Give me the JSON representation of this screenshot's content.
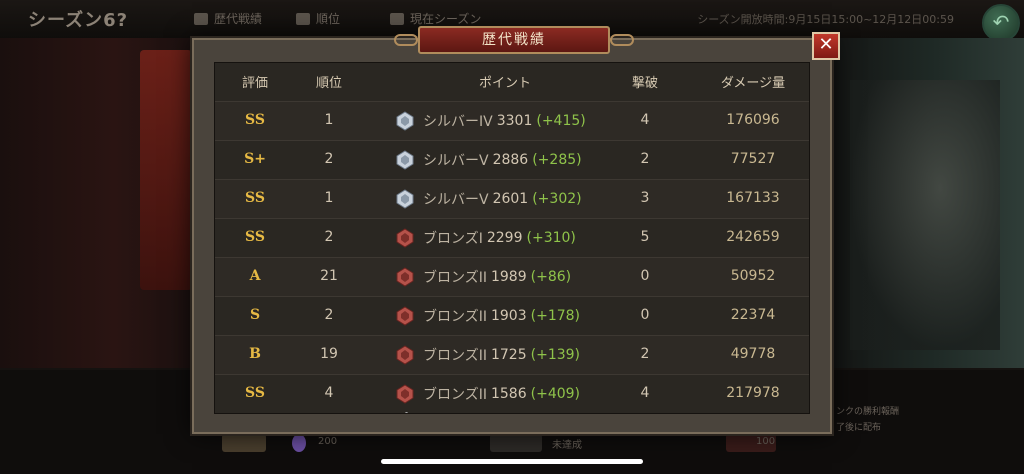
{
  "background": {
    "season_title": "シーズン6?",
    "tabs": [
      {
        "label": "歴代戦績"
      },
      {
        "label": "順位"
      },
      {
        "label": "現在シーズン"
      }
    ],
    "season_period": "シーズン開放時間:9月15日15:00~12月12日00:59",
    "right_note_1": "ンクの勝利報酬",
    "right_note_2": "了後に配布",
    "bottom_value_1": "200",
    "bottom_label_2": "未達成",
    "bottom_value_3": "100"
  },
  "modal": {
    "title": "歴代戦績",
    "close_label": "✕",
    "columns": {
      "grade": "評価",
      "rank": "順位",
      "points": "ポイント",
      "kills": "撃破",
      "damage": "ダメージ量"
    },
    "rows": [
      {
        "grade": "SS",
        "rank": "1",
        "tier": "シルバーIV",
        "medal": "silver",
        "points": "3301",
        "delta": "(+415)",
        "kills": "4",
        "damage": "176096"
      },
      {
        "grade": "S+",
        "rank": "2",
        "tier": "シルバーV",
        "medal": "silver",
        "points": "2886",
        "delta": "(+285)",
        "kills": "2",
        "damage": "77527"
      },
      {
        "grade": "SS",
        "rank": "1",
        "tier": "シルバーV",
        "medal": "silver",
        "points": "2601",
        "delta": "(+302)",
        "kills": "3",
        "damage": "167133"
      },
      {
        "grade": "SS",
        "rank": "2",
        "tier": "ブロンズI",
        "medal": "bronze",
        "points": "2299",
        "delta": "(+310)",
        "kills": "5",
        "damage": "242659"
      },
      {
        "grade": "A",
        "rank": "21",
        "tier": "ブロンズII",
        "medal": "bronze",
        "points": "1989",
        "delta": "(+86)",
        "kills": "0",
        "damage": "50952"
      },
      {
        "grade": "S",
        "rank": "2",
        "tier": "ブロンズII",
        "medal": "bronze",
        "points": "1903",
        "delta": "(+178)",
        "kills": "0",
        "damage": "22374"
      },
      {
        "grade": "B",
        "rank": "19",
        "tier": "ブロンズII",
        "medal": "bronze",
        "points": "1725",
        "delta": "(+139)",
        "kills": "2",
        "damage": "49778"
      },
      {
        "grade": "SS",
        "rank": "4",
        "tier": "ブロンズII",
        "medal": "bronze",
        "points": "1586",
        "delta": "(+409)",
        "kills": "4",
        "damage": "217978"
      }
    ]
  },
  "colors": {
    "grade_gold": "#e6b944",
    "delta_green": "#8fc34a",
    "title_red": "#8b2a22",
    "close_red": "#c2392c"
  }
}
